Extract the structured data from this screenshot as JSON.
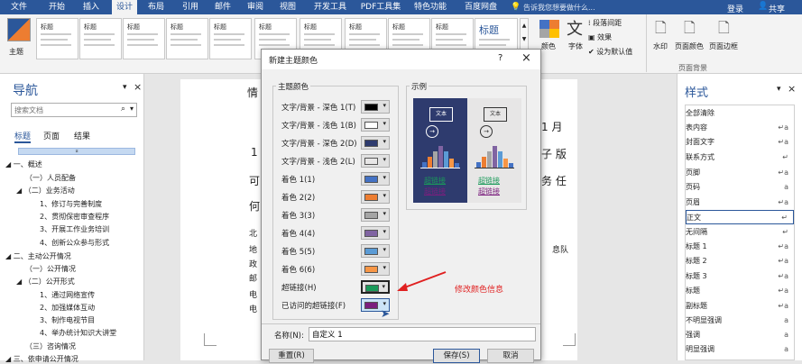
{
  "ribbon_tabs": [
    {
      "label": "文件"
    },
    {
      "label": "开始"
    },
    {
      "label": "插入"
    },
    {
      "label": "设计"
    },
    {
      "label": "布局"
    },
    {
      "label": "引用"
    },
    {
      "label": "邮件"
    },
    {
      "label": "审阅"
    },
    {
      "label": "视图"
    },
    {
      "label": "开发工具"
    },
    {
      "label": "PDF工具集"
    },
    {
      "label": "特色功能"
    },
    {
      "label": "百度网盘"
    }
  ],
  "tell_me": "告诉我您想要做什么...",
  "login": "登录",
  "share": "共享",
  "ribbon": {
    "theme_label": "主题",
    "gallery_titles": [
      "标题",
      "标题",
      "标题",
      "标题",
      "标题",
      "标题",
      "标题",
      "标题",
      "标题",
      "标题",
      "标题",
      "标题"
    ],
    "paragraph_spacing": "段落间距",
    "effects": "效果",
    "set_default": "设为默认值",
    "colors": "颜色",
    "fonts": "字体",
    "watermark": "水印",
    "page_color": "页面颜色",
    "page_border": "页面边框",
    "page_bg_group": "页面背景",
    "big_title": "标题"
  },
  "nav": {
    "title": "导航",
    "search_placeholder": "搜索文档",
    "tabs": [
      "标题",
      "页面",
      "结果"
    ],
    "items": [
      {
        "text": "一、概述"
      },
      {
        "text": "（一）人员配备"
      },
      {
        "text": "（二）业务活动"
      },
      {
        "text": "1、修订与完善制度"
      },
      {
        "text": "2、贯彻保密审查程序"
      },
      {
        "text": "3、开展工作业务培训"
      },
      {
        "text": "4、创新公众参与形式"
      },
      {
        "text": "二、主动公开情况"
      },
      {
        "text": "（一）公开情况"
      },
      {
        "text": "（二）公开形式"
      },
      {
        "text": "1、通过网络宣传"
      },
      {
        "text": "2、加强媒体互动"
      },
      {
        "text": "3、制作电视节目"
      },
      {
        "text": "4、举办统计知识大讲堂"
      },
      {
        "text": "（三）咨询情况"
      },
      {
        "text": "三、依申请公开情况"
      }
    ]
  },
  "doc": {
    "fragments": [
      "情",
      "1 月",
      "1",
      "子 版",
      "可",
      "务 任",
      "何",
      "北",
      "地",
      "息队",
      "政",
      "邮",
      "电",
      "电"
    ]
  },
  "styles": {
    "title": "样式",
    "items": [
      {
        "name": "全部清除",
        "mark": ""
      },
      {
        "name": "表内容",
        "mark": "↵a"
      },
      {
        "name": "封面文字",
        "mark": "↵a"
      },
      {
        "name": "联系方式",
        "mark": "↵"
      },
      {
        "name": "页脚",
        "mark": "↵a"
      },
      {
        "name": "页码",
        "mark": "a"
      },
      {
        "name": "页眉",
        "mark": "↵a"
      },
      {
        "name": "正文",
        "mark": "↵"
      },
      {
        "name": "无间隔",
        "mark": "↵"
      },
      {
        "name": "标题 1",
        "mark": "↵a"
      },
      {
        "name": "标题 2",
        "mark": "↵a"
      },
      {
        "name": "标题 3",
        "mark": "↵a"
      },
      {
        "name": "标题",
        "mark": "↵a"
      },
      {
        "name": "副标题",
        "mark": "↵a"
      },
      {
        "name": "不明显强调",
        "mark": "a"
      },
      {
        "name": "强调",
        "mark": "a"
      },
      {
        "name": "明显强调",
        "mark": "a"
      }
    ]
  },
  "dialog": {
    "title": "新建主题颜色",
    "help": "?",
    "close": "×",
    "group_title": "主题颜色",
    "preview_title": "示例",
    "rows": [
      {
        "label": "文字/背景 - 深色 1(T)",
        "color": "#000000"
      },
      {
        "label": "文字/背景 - 浅色 1(B)",
        "color": "#ffffff"
      },
      {
        "label": "文字/背景 - 深色 2(D)",
        "color": "#2e3b6e"
      },
      {
        "label": "文字/背景 - 浅色 2(L)",
        "color": "#e7e6e6"
      },
      {
        "label": "着色 1(1)",
        "color": "#4472c4"
      },
      {
        "label": "着色 2(2)",
        "color": "#ed7d31"
      },
      {
        "label": "着色 3(3)",
        "color": "#a5a5a5"
      },
      {
        "label": "着色 4(4)",
        "color": "#8064a2"
      },
      {
        "label": "着色 5(5)",
        "color": "#5b9bd5"
      },
      {
        "label": "着色 6(6)",
        "color": "#f79646"
      },
      {
        "label": "超链接(H)",
        "color": "#1a9a5a"
      },
      {
        "label": "已访问的超链接(F)",
        "color": "#7b1f7e"
      }
    ],
    "preview_text": "文本",
    "preview_link": "超链接",
    "preview_visited": "超链接",
    "name_label": "名称(N):",
    "name_value": "自定义 1",
    "reset": "重置(R)",
    "save": "保存(S)",
    "cancel": "取消"
  },
  "annotation": "修改颜色信息"
}
